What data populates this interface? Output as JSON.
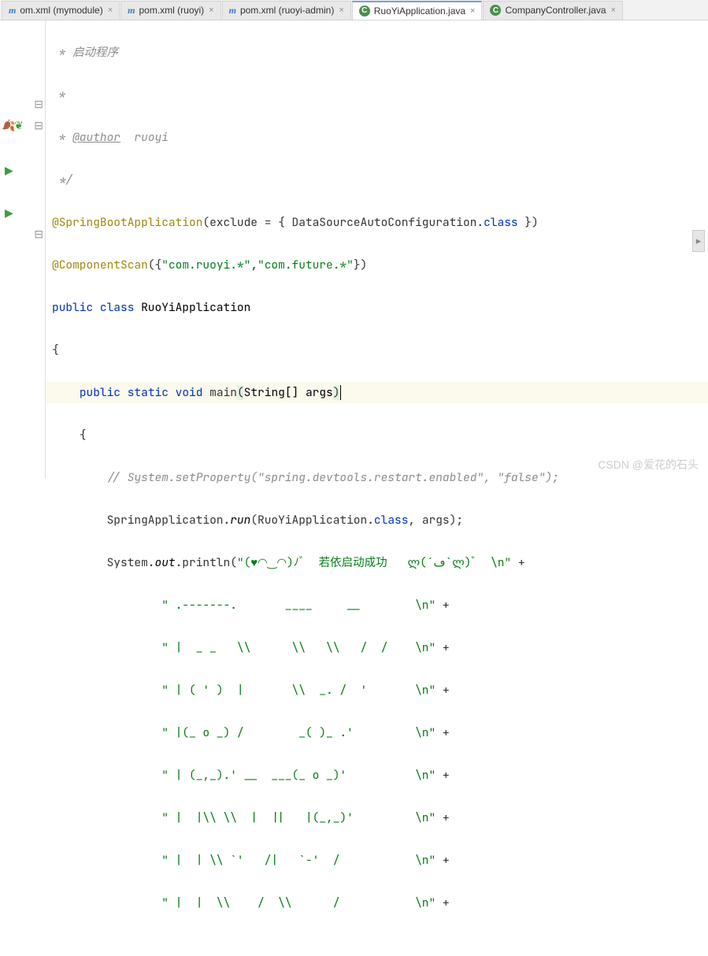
{
  "tabs": [
    {
      "label": "om.xml (mymodule)",
      "icon": "m",
      "active": false
    },
    {
      "label": "pom.xml (ruoyi)",
      "icon": "m",
      "active": false
    },
    {
      "label": "pom.xml (ruoyi-admin)",
      "icon": "m",
      "active": false
    },
    {
      "label": "RuoYiApplication.java",
      "icon": "c",
      "active": true
    },
    {
      "label": "CompanyController.java",
      "icon": "c",
      "active": false
    }
  ],
  "close_glyph": "×",
  "code": {
    "c1": " * 启动程序",
    "c2": " *",
    "c3": " * ",
    "c3_tag": "@author",
    "c3_val": "  ruoyi",
    "c4": " */",
    "ann1": "@SpringBootApplication",
    "ann1_rest_a": "(exclude = { DataSourceAutoConfiguration.",
    "ann1_rest_b": "class",
    "ann1_rest_c": " })",
    "ann2": "@ComponentScan",
    "ann2_open": "({",
    "ann2_s1": "\"com.ruoyi.*\"",
    "ann2_comma": ",",
    "ann2_s2": "\"com.future.*\"",
    "ann2_close": "})",
    "pub": "public",
    "cls_kw": "class",
    "cls_name": "RuoYiApplication",
    "brace_open": "{",
    "static_kw": "static",
    "void_kw": "void",
    "main": "main",
    "main_args_a": "(",
    "main_args_b": "String[] args",
    "main_args_c": ")",
    "brace_open2": "    {",
    "cmt_line": "        // System.setProperty(\"spring.devtools.restart.enabled\", \"false\");",
    "run_line_a": "        SpringApplication.",
    "run_line_m": "run",
    "run_line_b": "(RuoYiApplication.",
    "run_line_c": "class",
    "run_line_d": ", args);",
    "out_a": "        System.",
    "out_b": "out",
    "out_c": ".println(",
    "out_s": "\"(♥◠‿◠)ﾉﾞ  若依启动成功   ლ(´ڡ`ლ)ﾞ  \\n\"",
    "plus": " +",
    "a1": "                \" .-------.       ____     __        \\n\"",
    "a2": "                \" |  _ _   \\\\      \\\\   \\\\   /  /    \\n\"",
    "a3": "                \" | ( ' )  |       \\\\  _. /  '       \\n\"",
    "a4": "                \" |(_ o _) /        _( )_ .'         \\n\"",
    "a5": "                \" | (_,_).' __  ___(_ o _)'          \\n\"",
    "a6": "                \" |  |\\\\ \\\\  |  ||   |(_,_)'         \\n\"",
    "a7": "                \" |  | \\\\ `'   /|   `-'  /           \\n\"",
    "a8": "                \" |  |  \\\\    /  \\\\      /           \\n\""
  },
  "watermark": "CSDN @爱花的石头"
}
